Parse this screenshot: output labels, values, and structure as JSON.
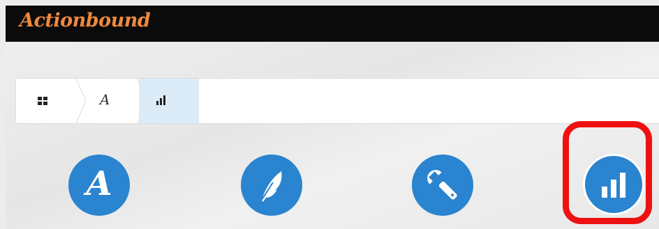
{
  "app": {
    "logo_text": "Actionbound",
    "logo_color": "#f08a3c"
  },
  "breadcrumb": {
    "items": [
      {
        "icon": "grid-icon"
      },
      {
        "icon": "author-a-icon",
        "glyph": "A"
      },
      {
        "icon": "stats-bars-icon",
        "active": true
      }
    ]
  },
  "tools": [
    {
      "icon": "author-a-icon",
      "glyph": "A"
    },
    {
      "icon": "feather-icon"
    },
    {
      "icon": "wrench-icon"
    },
    {
      "icon": "stats-bars-icon",
      "selected": true
    }
  ],
  "colors": {
    "accent_blue": "#2a84cf",
    "highlight_red": "#ee1111",
    "active_crumb_bg": "#dcebf8"
  }
}
